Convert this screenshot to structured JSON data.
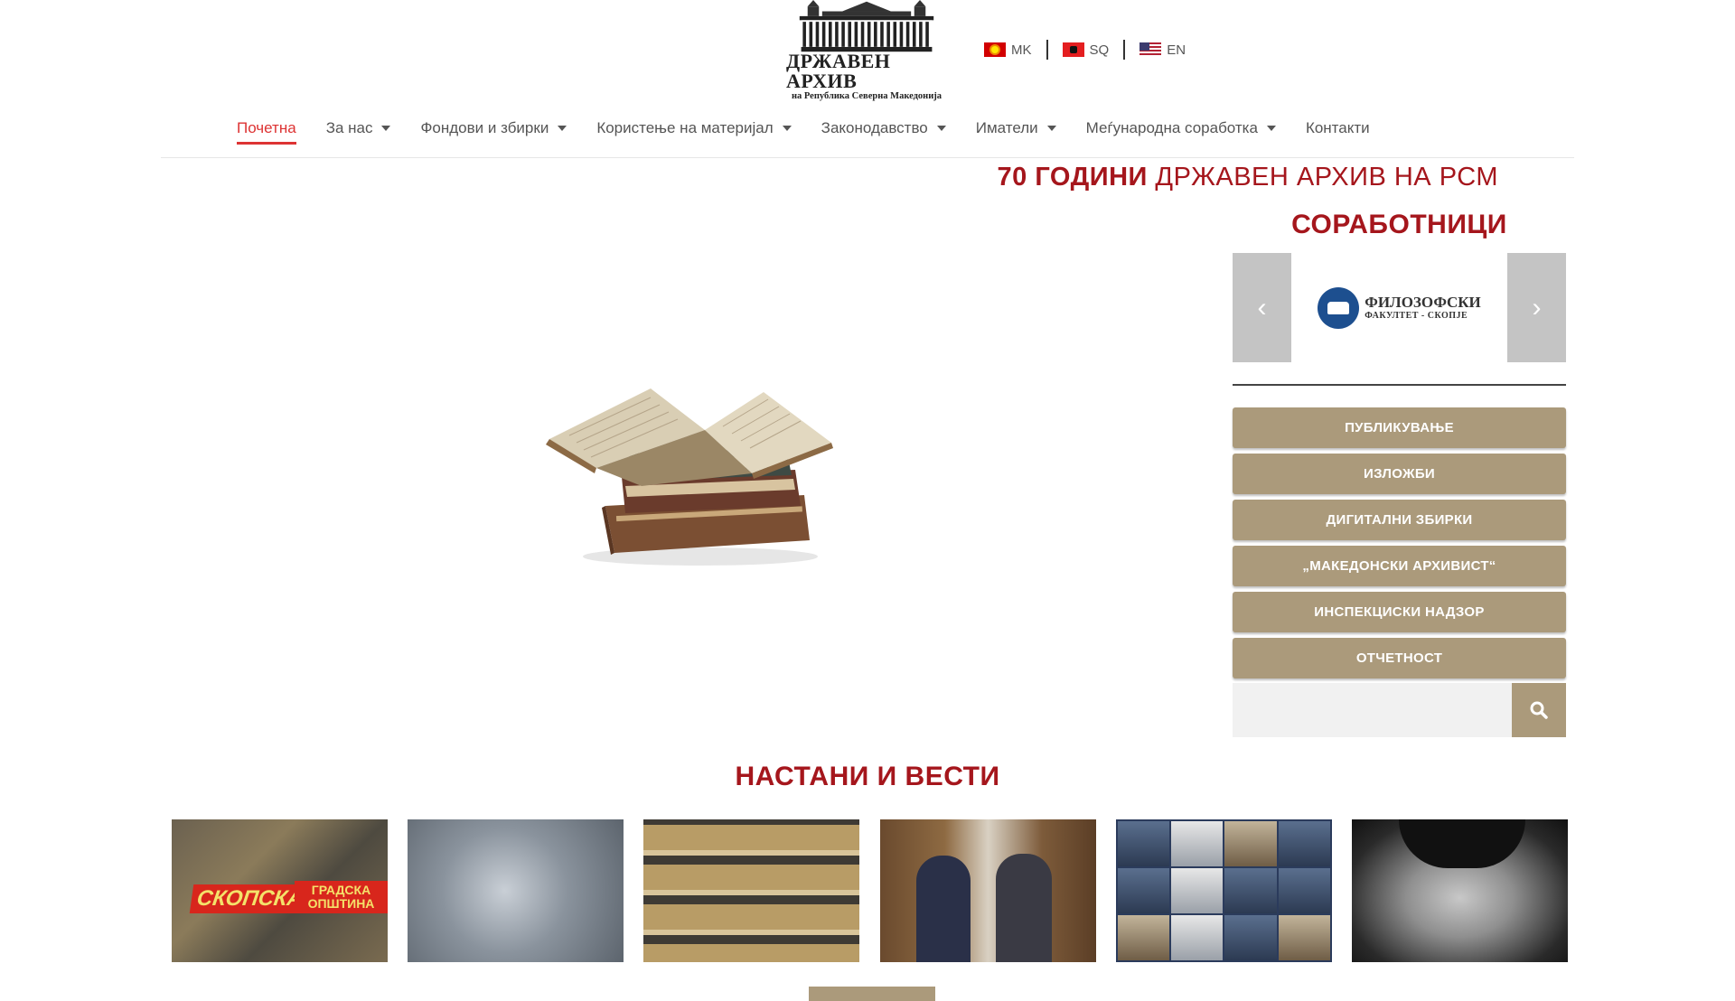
{
  "logo": {
    "title": "ДРЖАВЕН АРХИВ",
    "subtitle": "на Република Северна Македонија"
  },
  "languages": [
    {
      "code": "MK",
      "flag": "flag-mk"
    },
    {
      "code": "SQ",
      "flag": "flag-sq"
    },
    {
      "code": "EN",
      "flag": "flag-en"
    }
  ],
  "nav": {
    "items": [
      {
        "label": "Почетна",
        "active": true,
        "dropdown": false
      },
      {
        "label": "За нас",
        "active": false,
        "dropdown": true
      },
      {
        "label": "Фондови и збирки",
        "active": false,
        "dropdown": true
      },
      {
        "label": "Користење на материјал",
        "active": false,
        "dropdown": true
      },
      {
        "label": "Законодавство",
        "active": false,
        "dropdown": true
      },
      {
        "label": "Иматели",
        "active": false,
        "dropdown": true
      },
      {
        "label": "Меѓународна соработка",
        "active": false,
        "dropdown": true
      },
      {
        "label": "Контакти",
        "active": false,
        "dropdown": false
      }
    ]
  },
  "headline": {
    "bold": "70 ГОДИНИ",
    "rest": " ДРЖАВЕН АРХИВ НА РСМ"
  },
  "partners": {
    "title": "СОРАБОТНИЦИ",
    "slide_name": "ФИЛОЗОФСКИ",
    "slide_sub": "ФАКУЛТЕТ - СКОПЈЕ",
    "prev_icon": "chevron-left-icon",
    "next_icon": "chevron-right-icon"
  },
  "side_buttons": [
    "ПУБЛИКУВАЊЕ",
    "ИЗЛОЖБИ",
    "ДИГИТАЛНИ ЗБИРКИ",
    "„МАКЕДОНСКИ АРХИВИСТ“",
    "ИНСПЕКЦИСКИ НАДЗОР",
    "ОТЧЕТНОСТ"
  ],
  "search": {
    "placeholder": "",
    "icon": "search-icon"
  },
  "news": {
    "title": "НАСТАНИ И ВЕСТИ",
    "card1_stamp": "СКОПСКА",
    "card1_stamp2": "ГРАДСКА ОПШТИНА"
  },
  "colors": {
    "brand_red": "#a5161c",
    "nav_active": "#dd3333",
    "button_tan": "#ab9a7b"
  }
}
